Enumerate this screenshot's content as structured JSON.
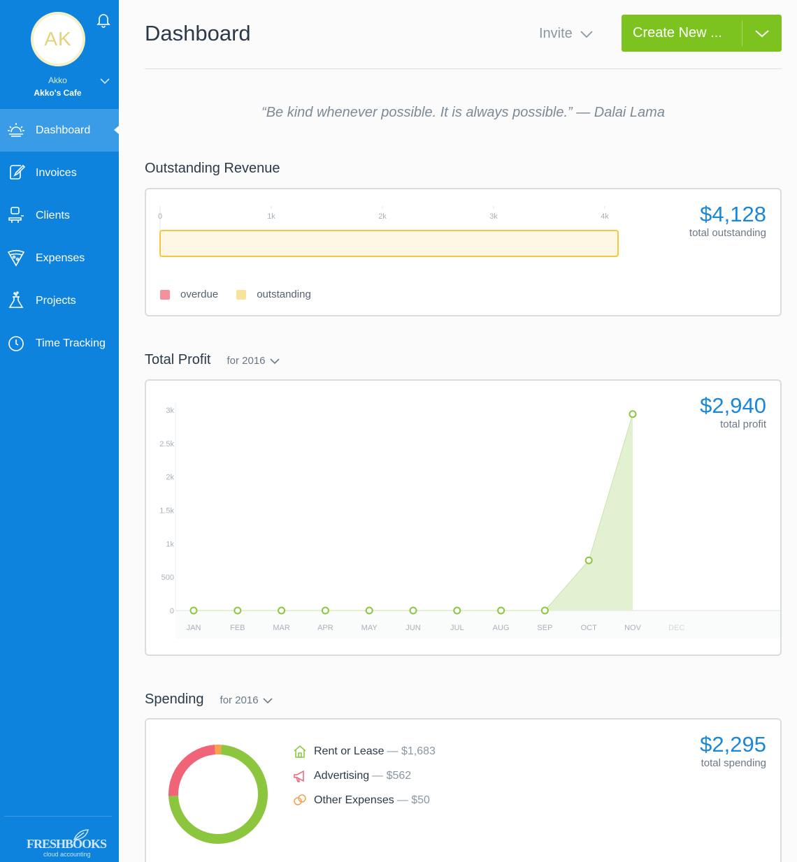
{
  "user": {
    "initials": "AK",
    "name": "Akko",
    "company": "Akko's Cafe"
  },
  "nav": [
    {
      "label": "Dashboard",
      "icon": "sunrise-icon",
      "active": true
    },
    {
      "label": "Invoices",
      "icon": "invoice-quill-icon"
    },
    {
      "label": "Clients",
      "icon": "client-person-icon"
    },
    {
      "label": "Expenses",
      "icon": "pizza-slice-icon"
    },
    {
      "label": "Projects",
      "icon": "flask-icon"
    },
    {
      "label": "Time Tracking",
      "icon": "stopwatch-icon"
    }
  ],
  "logo": {
    "text": "FRESHBOOKS",
    "sub": "cloud accounting"
  },
  "header": {
    "title": "Dashboard",
    "invite_label": "Invite",
    "create_label": "Create New ..."
  },
  "quote": "“Be kind whenever possible. It is always possible.” — Dalai Lama",
  "outstanding": {
    "title": "Outstanding Revenue",
    "amount": "$4,128",
    "amount_label": "total outstanding",
    "legend": [
      {
        "label": "overdue",
        "color": "#f5919b"
      },
      {
        "label": "outstanding",
        "color": "#f7e49a"
      }
    ]
  },
  "profit": {
    "title": "Total Profit",
    "filter": "for 2016",
    "amount": "$2,940",
    "amount_label": "total profit"
  },
  "spending": {
    "title": "Spending",
    "filter": "for 2016",
    "amount": "$2,295",
    "amount_label": "total spending",
    "items": [
      {
        "label": "Rent or Lease",
        "value": "$1,683",
        "icon": "house-icon",
        "color": "#8cc63f"
      },
      {
        "label": "Advertising",
        "value": "$562",
        "icon": "megaphone-icon",
        "color": "#f06478"
      },
      {
        "label": "Other Expenses",
        "value": "$50",
        "icon": "coins-icon",
        "color": "#f5a14d"
      }
    ]
  },
  "colors": {
    "sidebar": "#0d83dd",
    "accent": "#7cc320",
    "link": "#1b87d8"
  },
  "chart_data": [
    {
      "type": "bar",
      "title": "Outstanding Revenue",
      "orientation": "horizontal",
      "xlim": [
        0,
        4000
      ],
      "ticks": [
        "0",
        "1k",
        "2k",
        "3k",
        "4k"
      ],
      "series": [
        {
          "name": "overdue",
          "values": [
            0
          ]
        },
        {
          "name": "outstanding",
          "values": [
            4128
          ]
        }
      ]
    },
    {
      "type": "area",
      "title": "Total Profit",
      "categories": [
        "JAN",
        "FEB",
        "MAR",
        "APR",
        "MAY",
        "JUN",
        "JUL",
        "AUG",
        "SEP",
        "OCT",
        "NOV",
        "DEC"
      ],
      "values": [
        0,
        0,
        0,
        0,
        0,
        0,
        0,
        0,
        0,
        750,
        2940,
        null
      ],
      "ylim": [
        0,
        3000
      ],
      "yticks": [
        "0",
        "500",
        "1k",
        "1.5k",
        "2k",
        "2.5k",
        "3k"
      ],
      "grid": false
    },
    {
      "type": "pie",
      "title": "Spending",
      "donut": true,
      "categories": [
        "Rent or Lease",
        "Advertising",
        "Other Expenses"
      ],
      "values": [
        1683,
        562,
        50
      ]
    }
  ]
}
